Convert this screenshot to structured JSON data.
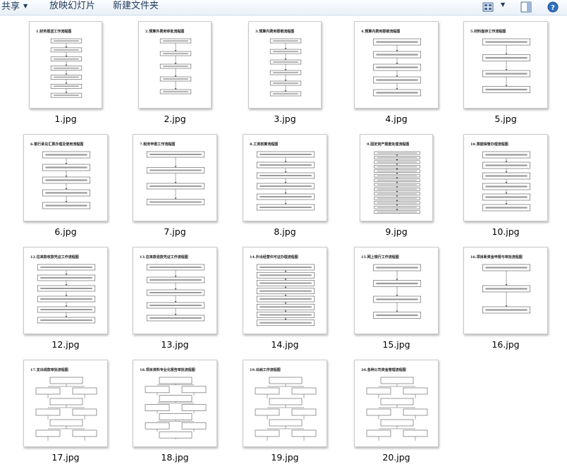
{
  "toolbar": {
    "share_label": "共享",
    "slideshow_label": "放映幻灯片",
    "new_folder_label": "新建文件夹",
    "icons": [
      "view-options-icon",
      "preview-pane-icon",
      "help-icon"
    ]
  },
  "files": [
    {
      "name": "1.jpg",
      "title": "1.财务报送工作流程图"
    },
    {
      "name": "2.jpg",
      "title": "2.预算外费用审批流程图"
    },
    {
      "name": "3.jpg",
      "title": "3.预算内费用报销流程图"
    },
    {
      "name": "4.jpg",
      "title": "4.预算内费用报销流程图"
    },
    {
      "name": "5.jpg",
      "title": "5.材料盘存工作流程图"
    },
    {
      "name": "6.jpg",
      "title": "6.银行承兑汇票办理及使用流程图"
    },
    {
      "name": "7.jpg",
      "title": "7.税务申报工作流程图"
    },
    {
      "name": "8.jpg",
      "title": "8.工资核算流程图"
    },
    {
      "name": "9.jpg",
      "title": "9.固定资产报废处理流程图"
    },
    {
      "name": "10.jpg",
      "title": "10.票据保管办理流程图"
    },
    {
      "name": "12.jpg",
      "title": "12.往来款收款凭证工作流程图"
    },
    {
      "name": "13.jpg",
      "title": "13.往来款退款凭证工作流程图"
    },
    {
      "name": "14.jpg",
      "title": "14.外出经营许可证办理流程图"
    },
    {
      "name": "15.jpg",
      "title": "15.网上银行工作流程图"
    },
    {
      "name": "16.jpg",
      "title": "16.项目新资金申报与审批流程图"
    },
    {
      "name": "17.jpg",
      "title": "17.支出线款审批流程图"
    },
    {
      "name": "18.jpg",
      "title": "18.项目资料专业化报告审批流程图"
    },
    {
      "name": "19.jpg",
      "title": "19.出纳工作流程图"
    },
    {
      "name": "20.jpg",
      "title": "20.各种公司资金管理流程图"
    }
  ],
  "colors": {
    "toolbar_text": "#1e395b",
    "thumbnail_border": "#c9c9c9",
    "flow_line": "#555555"
  }
}
